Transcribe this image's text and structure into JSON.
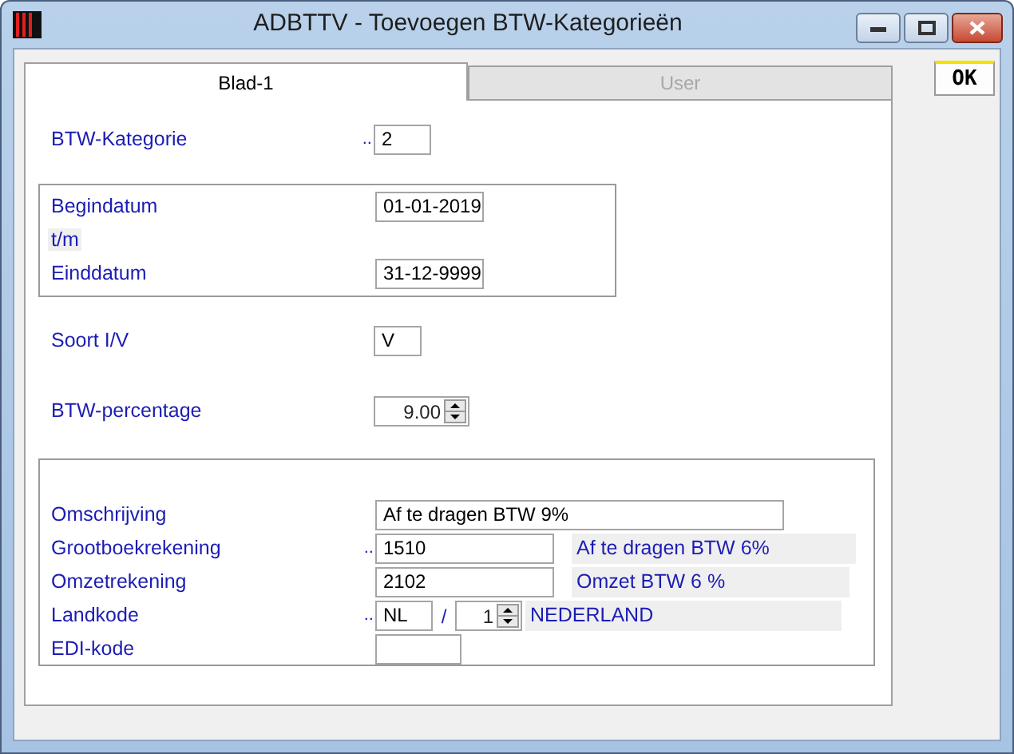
{
  "window": {
    "title": "ADBTTV - Toevoegen BTW-Kategorieën"
  },
  "tabs": [
    {
      "label": "Blad-1",
      "selected": true
    },
    {
      "label": "User",
      "selected": false
    }
  ],
  "ok_button": {
    "label": "OK"
  },
  "sections": [
    {
      "boxed": false,
      "rows": [
        {
          "kind": "code",
          "label": "BTW-Kategorie",
          "marker": "..",
          "value": "2"
        }
      ]
    },
    {
      "boxed": true,
      "rows": [
        {
          "kind": "date",
          "label": "Begindatum",
          "value": "01-01-2019"
        },
        {
          "kind": "caption",
          "label": "t/m"
        },
        {
          "kind": "date",
          "label": "Einddatum",
          "value": "31-12-9999"
        }
      ]
    },
    {
      "boxed": false,
      "rows": [
        {
          "kind": "short",
          "label": "Soort I/V",
          "value": "V"
        }
      ]
    },
    {
      "boxed": false,
      "rows": [
        {
          "kind": "spin",
          "label": "BTW-percentage",
          "value": "9.00"
        }
      ]
    },
    {
      "boxed": true,
      "rows": [
        {
          "kind": "wide",
          "label": "Omschrijving",
          "value": "Af te dragen BTW 9%"
        },
        {
          "kind": "account",
          "label": "Grootboekrekening",
          "marker": "..",
          "value": "1510",
          "description": "Af te dragen BTW 6%"
        },
        {
          "kind": "account",
          "label": "Omzetrekening",
          "value": "2102",
          "description": "Omzet BTW 6 %"
        },
        {
          "kind": "country",
          "label": "Landkode",
          "marker": "..",
          "value": "NL",
          "separator": "/",
          "number": "1",
          "description": "NEDERLAND"
        },
        {
          "kind": "edi",
          "label": "EDI-kode"
        }
      ]
    }
  ]
}
